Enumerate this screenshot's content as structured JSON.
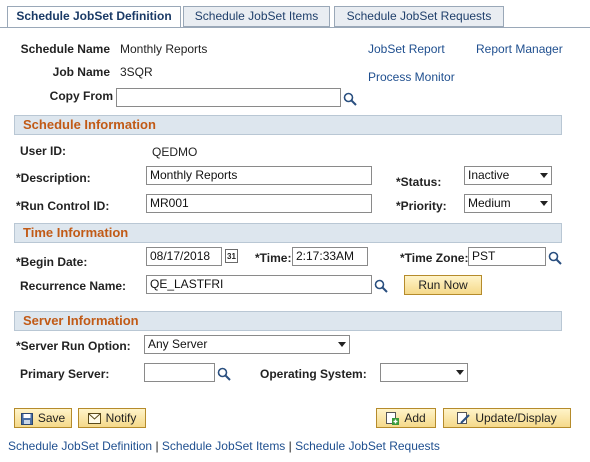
{
  "tabs": [
    {
      "label": "Schedule JobSet Definition",
      "active": true
    },
    {
      "label": "Schedule JobSet Items",
      "active": false
    },
    {
      "label": "Schedule JobSet Requests",
      "active": false
    }
  ],
  "header": {
    "schedule_name_label": "Schedule Name",
    "schedule_name_value": "Monthly Reports",
    "job_name_label": "Job Name",
    "job_name_value": "3SQR",
    "copy_from_label": "Copy From",
    "copy_from_value": "",
    "links": {
      "jobset_report": "JobSet Report",
      "report_manager": "Report Manager",
      "process_monitor": "Process Monitor"
    }
  },
  "schedule_info": {
    "title": "Schedule Information",
    "user_id_label": "User ID:",
    "user_id_value": "QEDMO",
    "description_label": "*Description:",
    "description_value": "Monthly Reports",
    "status_label": "*Status:",
    "status_value": "Inactive",
    "run_control_label": "*Run Control ID:",
    "run_control_value": "MR001",
    "priority_label": "*Priority:",
    "priority_value": "Medium"
  },
  "time_info": {
    "title": "Time Information",
    "begin_date_label": "*Begin Date:",
    "begin_date_value": "08/17/2018",
    "calendar_glyph": "31",
    "time_label": "*Time:",
    "time_value": "2:17:33AM",
    "time_zone_label": "*Time Zone:",
    "time_zone_value": "PST",
    "recurrence_label": "Recurrence Name:",
    "recurrence_value": "QE_LASTFRI",
    "run_now_label": "Run Now"
  },
  "server_info": {
    "title": "Server Information",
    "server_run_option_label": "*Server Run Option:",
    "server_run_option_value": "Any Server",
    "primary_server_label": "Primary Server:",
    "primary_server_value": "",
    "os_label": "Operating System:",
    "os_value": ""
  },
  "toolbar": {
    "save_label": "Save",
    "notify_label": "Notify",
    "add_label": "Add",
    "update_display_label": "Update/Display"
  },
  "footer_links": {
    "definition": "Schedule JobSet Definition",
    "items": "Schedule JobSet Items",
    "requests": "Schedule JobSet Requests",
    "separator": "|"
  },
  "colors": {
    "section_title": "#c15a16",
    "link": "#1f4f8f",
    "section_bg": "#dde6ee",
    "button_bg": "#f5d98a"
  }
}
